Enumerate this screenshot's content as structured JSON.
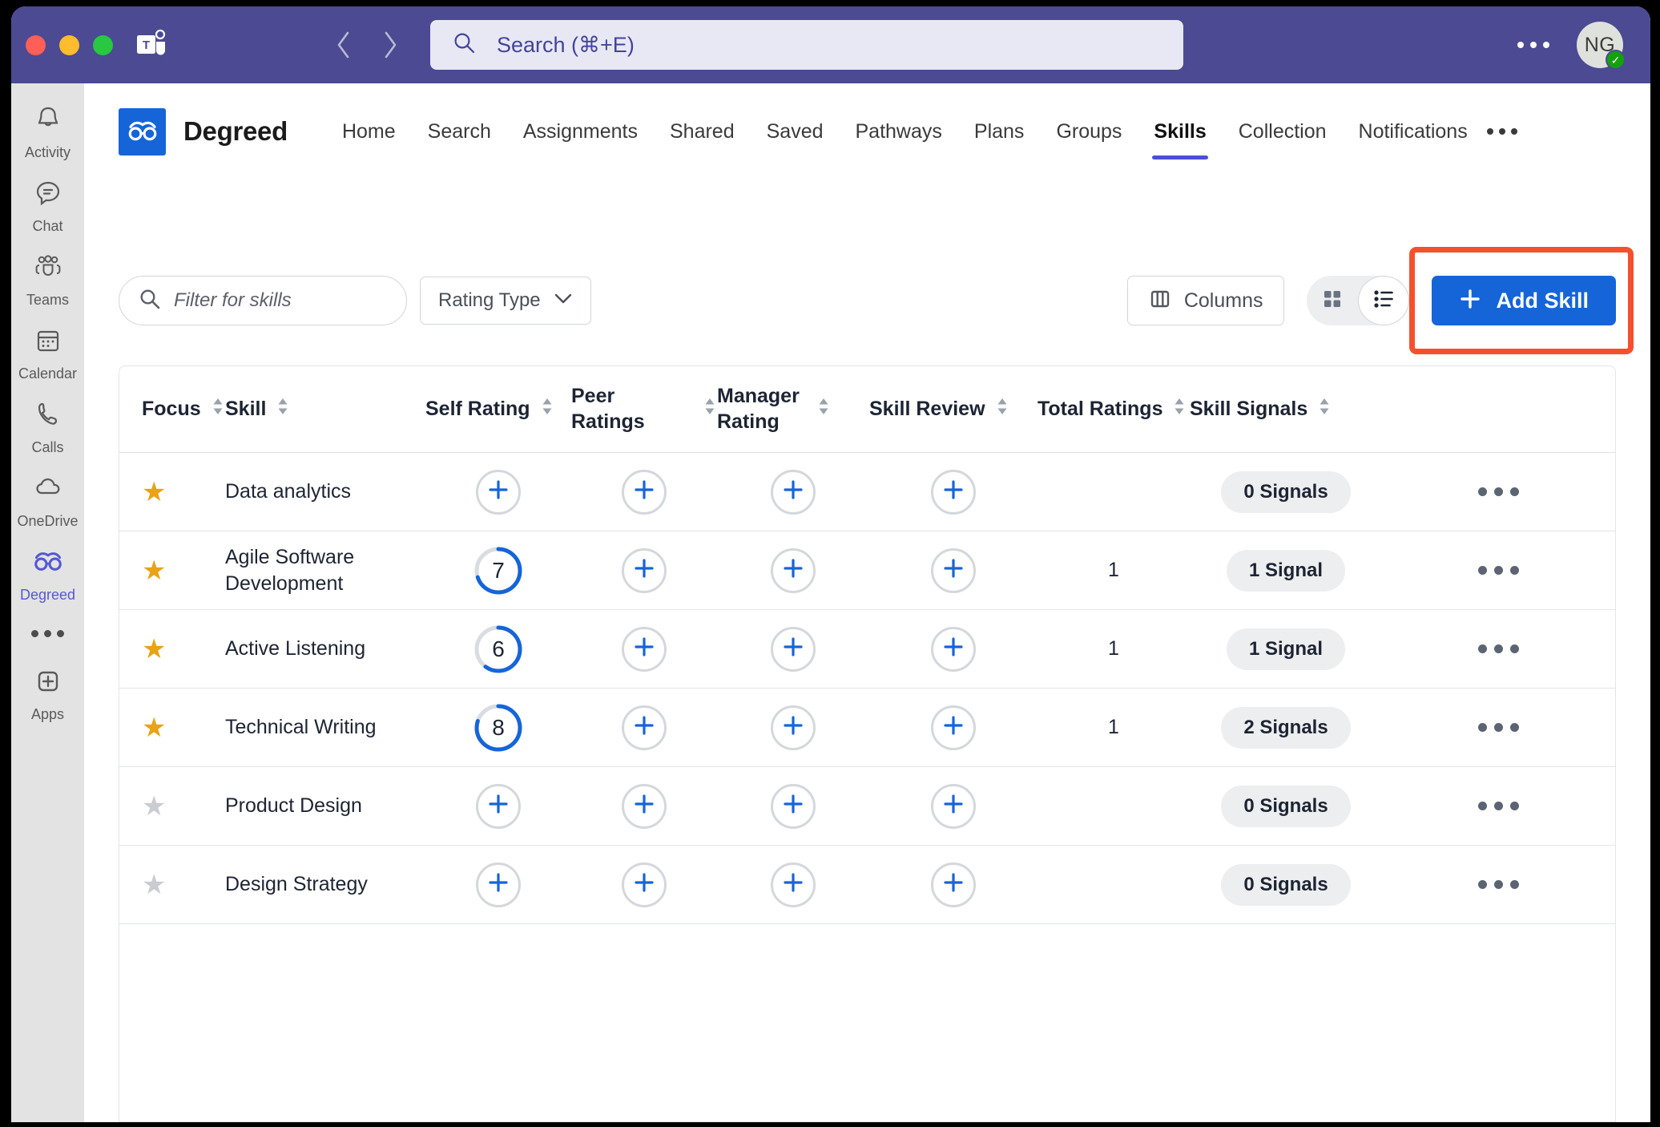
{
  "titlebar": {
    "window_controls": [
      "close",
      "minimize",
      "maximize"
    ],
    "app_logo": "microsoft-teams-logo",
    "back_label": "‹",
    "forward_label": "›",
    "search_placeholder": "Search (⌘+E)",
    "overflow_label": "more-options",
    "avatar_initials": "NG",
    "presence_status": "available"
  },
  "rail": {
    "items": [
      {
        "label": "Activity",
        "icon": "bell-icon",
        "active": false
      },
      {
        "label": "Chat",
        "icon": "chat-icon",
        "active": false
      },
      {
        "label": "Teams",
        "icon": "teams-people-icon",
        "active": false
      },
      {
        "label": "Calendar",
        "icon": "calendar-icon",
        "active": false
      },
      {
        "label": "Calls",
        "icon": "phone-icon",
        "active": false
      },
      {
        "label": "OneDrive",
        "icon": "cloud-icon",
        "active": false
      },
      {
        "label": "Degreed",
        "icon": "degreed-glasses-icon",
        "active": true
      }
    ],
    "more_label": "more-apps",
    "apps_label": "Apps"
  },
  "app": {
    "brand_name": "Degreed",
    "brand_icon": "degreed-glasses-icon",
    "nav": [
      {
        "label": "Home",
        "active": false
      },
      {
        "label": "Search",
        "active": false
      },
      {
        "label": "Assignments",
        "active": false
      },
      {
        "label": "Shared",
        "active": false
      },
      {
        "label": "Saved",
        "active": false
      },
      {
        "label": "Pathways",
        "active": false
      },
      {
        "label": "Plans",
        "active": false
      },
      {
        "label": "Groups",
        "active": false
      },
      {
        "label": "Skills",
        "active": true
      },
      {
        "label": "Collection",
        "active": false
      },
      {
        "label": "Notifications",
        "active": false
      }
    ],
    "nav_overflow": "more-nav-items"
  },
  "toolbar": {
    "filter_placeholder": "Filter for skills",
    "filter_value": "",
    "rating_type_label": "Rating Type",
    "columns_label": "Columns",
    "view_grid_label": "grid-view",
    "view_list_label": "list-view",
    "active_view": "list",
    "add_skill_label": "Add Skill",
    "add_skill_highlighted": true,
    "accent_color": "#1565d8",
    "highlight_color": "#f4502e"
  },
  "table": {
    "columns": [
      {
        "label": "Focus",
        "sortable": true
      },
      {
        "label": "Skill",
        "sortable": true
      },
      {
        "label": "Self Rating",
        "sortable": true
      },
      {
        "label": "Peer Ratings",
        "sortable": true
      },
      {
        "label": "Manager Rating",
        "sortable": true
      },
      {
        "label": "Skill Review",
        "sortable": true
      },
      {
        "label": "Total Ratings",
        "sortable": true
      },
      {
        "label": "Skill Signals",
        "sortable": true
      }
    ],
    "rows": [
      {
        "focus": true,
        "skill": "Data analytics",
        "self_rating": null,
        "peer_rating": null,
        "manager_rating": null,
        "skill_review": null,
        "total_ratings": "",
        "signals": "0 Signals"
      },
      {
        "focus": true,
        "skill": "Agile Software Development",
        "self_rating": 7,
        "peer_rating": null,
        "manager_rating": null,
        "skill_review": null,
        "total_ratings": "1",
        "signals": "1 Signal"
      },
      {
        "focus": true,
        "skill": "Active Listening",
        "self_rating": 6,
        "peer_rating": null,
        "manager_rating": null,
        "skill_review": null,
        "total_ratings": "1",
        "signals": "1 Signal"
      },
      {
        "focus": true,
        "skill": "Technical Writing",
        "self_rating": 8,
        "peer_rating": null,
        "manager_rating": null,
        "skill_review": null,
        "total_ratings": "1",
        "signals": "2 Signals"
      },
      {
        "focus": false,
        "skill": "Product Design",
        "self_rating": null,
        "peer_rating": null,
        "manager_rating": null,
        "skill_review": null,
        "total_ratings": "",
        "signals": "0 Signals"
      },
      {
        "focus": false,
        "skill": "Design Strategy",
        "self_rating": null,
        "peer_rating": null,
        "manager_rating": null,
        "skill_review": null,
        "total_ratings": "",
        "signals": "0 Signals"
      }
    ],
    "rating_max": 10,
    "add_rating_icon": "plus-icon",
    "row_menu_icon": "ellipsis-icon"
  }
}
